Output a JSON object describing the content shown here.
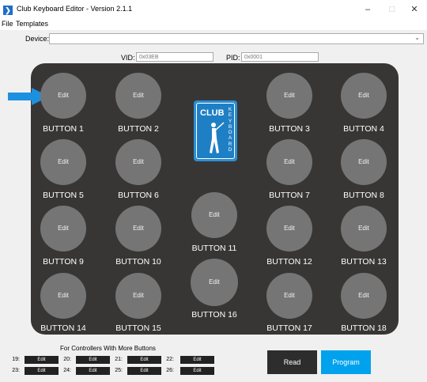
{
  "window": {
    "title": "Club Keyboard Editor - Version 2.1.1",
    "app_icon_glyph": "❯",
    "minimize": "–",
    "maximize": "□",
    "close": "✕"
  },
  "menu": {
    "file": "File",
    "templates": "Templates"
  },
  "device": {
    "label": "Device:",
    "value": "",
    "arrow": "⌄"
  },
  "vid": {
    "label": "VID:",
    "placeholder": "0x03EB"
  },
  "pid": {
    "label": "PID:",
    "placeholder": "0x0001"
  },
  "logo": {
    "club": "CLUB",
    "keyboard": [
      "K",
      "E",
      "Y",
      "B",
      "O",
      "A",
      "R",
      "D"
    ]
  },
  "buttons": [
    {
      "edit": "Edit",
      "label": "BUTTON 1"
    },
    {
      "edit": "Edit",
      "label": "BUTTON 2"
    },
    {
      "edit": "Edit",
      "label": "BUTTON 3"
    },
    {
      "edit": "Edit",
      "label": "BUTTON 4"
    },
    {
      "edit": "Edit",
      "label": "BUTTON 5"
    },
    {
      "edit": "Edit",
      "label": "BUTTON 6"
    },
    {
      "edit": "Edit",
      "label": "BUTTON 7"
    },
    {
      "edit": "Edit",
      "label": "BUTTON 8"
    },
    {
      "edit": "Edit",
      "label": "BUTTON 9"
    },
    {
      "edit": "Edit",
      "label": "BUTTON 10"
    },
    {
      "edit": "Edit",
      "label": "BUTTON 11"
    },
    {
      "edit": "Edit",
      "label": "BUTTON 12"
    },
    {
      "edit": "Edit",
      "label": "BUTTON 13"
    },
    {
      "edit": "Edit",
      "label": "BUTTON 14"
    },
    {
      "edit": "Edit",
      "label": "BUTTON 15"
    },
    {
      "edit": "Edit",
      "label": "BUTTON 16"
    },
    {
      "edit": "Edit",
      "label": "BUTTON 17"
    },
    {
      "edit": "Edit",
      "label": "BUTTON 18"
    }
  ],
  "extra": {
    "heading": "For Controllers With More Buttons",
    "slots": [
      {
        "num": "19:",
        "edit": "Edit"
      },
      {
        "num": "20:",
        "edit": "Edit"
      },
      {
        "num": "21:",
        "edit": "Edit"
      },
      {
        "num": "22:",
        "edit": "Edit"
      },
      {
        "num": "23:",
        "edit": "Edit"
      },
      {
        "num": "24:",
        "edit": "Edit"
      },
      {
        "num": "25:",
        "edit": "Edit"
      },
      {
        "num": "26:",
        "edit": "Edit"
      }
    ]
  },
  "actions": {
    "read": "Read",
    "program": "Program"
  },
  "colors": {
    "panel": "#383635",
    "circle": "#757575",
    "accent": "#00a2ed",
    "read_bg": "#2d2d2d",
    "pointer": "#1e90e0",
    "logo": "#2b8fd6"
  }
}
